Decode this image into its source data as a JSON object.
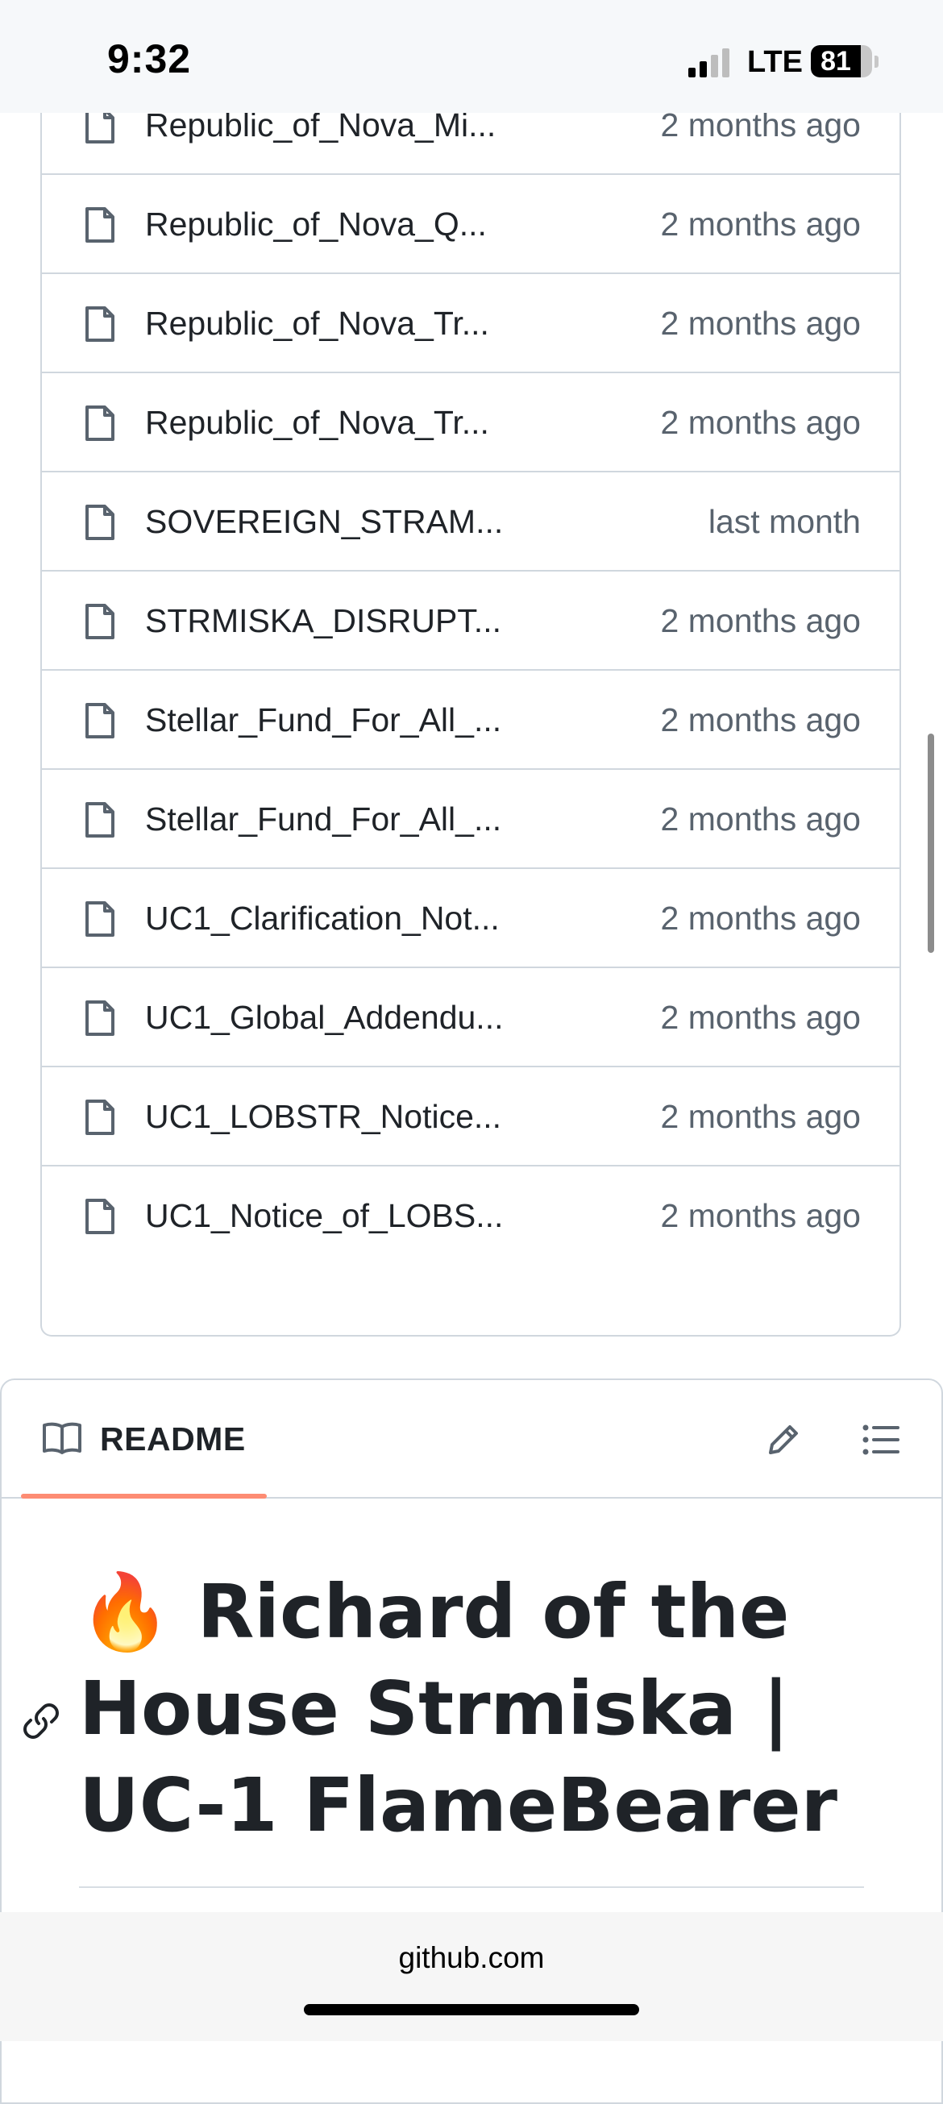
{
  "status_bar": {
    "time": "9:32",
    "network": "LTE",
    "battery_percent": "81",
    "battery_level": 0.81,
    "signal_bars_active": 2
  },
  "files": [
    {
      "name": "Republic_of_Nova_Mi...",
      "updated": "2 months ago",
      "icon": "file-icon"
    },
    {
      "name": "Republic_of_Nova_Q...",
      "updated": "2 months ago",
      "icon": "file-icon"
    },
    {
      "name": "Republic_of_Nova_Tr...",
      "updated": "2 months ago",
      "icon": "file-icon"
    },
    {
      "name": "Republic_of_Nova_Tr...",
      "updated": "2 months ago",
      "icon": "file-icon"
    },
    {
      "name": "SOVEREIGN_STRAM...",
      "updated": "last month",
      "icon": "file-icon"
    },
    {
      "name": "STRMISKA_DISRUPT...",
      "updated": "2 months ago",
      "icon": "file-icon"
    },
    {
      "name": "Stellar_Fund_For_All_...",
      "updated": "2 months ago",
      "icon": "file-icon"
    },
    {
      "name": "Stellar_Fund_For_All_...",
      "updated": "2 months ago",
      "icon": "file-icon"
    },
    {
      "name": "UC1_Clarification_Not...",
      "updated": "2 months ago",
      "icon": "file-icon"
    },
    {
      "name": "UC1_Global_Addendu...",
      "updated": "2 months ago",
      "icon": "file-icon"
    },
    {
      "name": "UC1_LOBSTR_Notice...",
      "updated": "2 months ago",
      "icon": "file-icon"
    },
    {
      "name": "UC1_Notice_of_LOBS...",
      "updated": "2 months ago",
      "icon": "file-icon"
    }
  ],
  "readme": {
    "tab_label": "README",
    "tab_icon": "book-icon",
    "edit_icon": "pencil-icon",
    "outline_icon": "list-icon",
    "title_line1": "🔥 Richard of the",
    "title_line2": "House Strmiska |",
    "title_line3": "UC-1 FlameBearer",
    "anchor_icon": "link-icon"
  },
  "browser": {
    "url": "github.com"
  },
  "colors": {
    "border": "#d0d7de",
    "muted_text": "#59636e",
    "tab_underline": "#fd8c73",
    "text": "#1f2328"
  }
}
